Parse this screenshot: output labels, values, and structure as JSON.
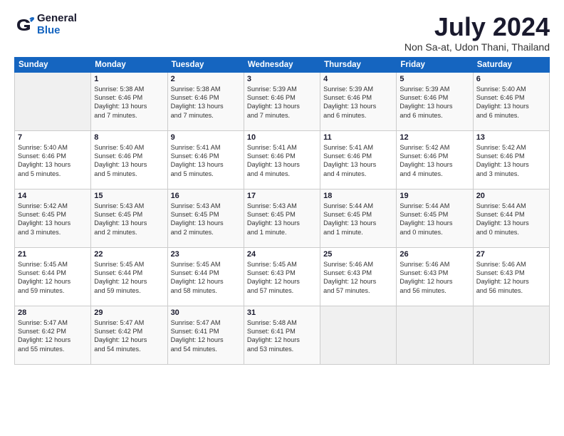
{
  "logo": {
    "general": "General",
    "blue": "Blue"
  },
  "title": "July 2024",
  "subtitle": "Non Sa-at, Udon Thani, Thailand",
  "headers": [
    "Sunday",
    "Monday",
    "Tuesday",
    "Wednesday",
    "Thursday",
    "Friday",
    "Saturday"
  ],
  "weeks": [
    [
      {
        "day": "",
        "info": ""
      },
      {
        "day": "1",
        "info": "Sunrise: 5:38 AM\nSunset: 6:46 PM\nDaylight: 13 hours\nand 7 minutes."
      },
      {
        "day": "2",
        "info": "Sunrise: 5:38 AM\nSunset: 6:46 PM\nDaylight: 13 hours\nand 7 minutes."
      },
      {
        "day": "3",
        "info": "Sunrise: 5:39 AM\nSunset: 6:46 PM\nDaylight: 13 hours\nand 7 minutes."
      },
      {
        "day": "4",
        "info": "Sunrise: 5:39 AM\nSunset: 6:46 PM\nDaylight: 13 hours\nand 6 minutes."
      },
      {
        "day": "5",
        "info": "Sunrise: 5:39 AM\nSunset: 6:46 PM\nDaylight: 13 hours\nand 6 minutes."
      },
      {
        "day": "6",
        "info": "Sunrise: 5:40 AM\nSunset: 6:46 PM\nDaylight: 13 hours\nand 6 minutes."
      }
    ],
    [
      {
        "day": "7",
        "info": "Sunrise: 5:40 AM\nSunset: 6:46 PM\nDaylight: 13 hours\nand 5 minutes."
      },
      {
        "day": "8",
        "info": "Sunrise: 5:40 AM\nSunset: 6:46 PM\nDaylight: 13 hours\nand 5 minutes."
      },
      {
        "day": "9",
        "info": "Sunrise: 5:41 AM\nSunset: 6:46 PM\nDaylight: 13 hours\nand 5 minutes."
      },
      {
        "day": "10",
        "info": "Sunrise: 5:41 AM\nSunset: 6:46 PM\nDaylight: 13 hours\nand 4 minutes."
      },
      {
        "day": "11",
        "info": "Sunrise: 5:41 AM\nSunset: 6:46 PM\nDaylight: 13 hours\nand 4 minutes."
      },
      {
        "day": "12",
        "info": "Sunrise: 5:42 AM\nSunset: 6:46 PM\nDaylight: 13 hours\nand 4 minutes."
      },
      {
        "day": "13",
        "info": "Sunrise: 5:42 AM\nSunset: 6:46 PM\nDaylight: 13 hours\nand 3 minutes."
      }
    ],
    [
      {
        "day": "14",
        "info": "Sunrise: 5:42 AM\nSunset: 6:45 PM\nDaylight: 13 hours\nand 3 minutes."
      },
      {
        "day": "15",
        "info": "Sunrise: 5:43 AM\nSunset: 6:45 PM\nDaylight: 13 hours\nand 2 minutes."
      },
      {
        "day": "16",
        "info": "Sunrise: 5:43 AM\nSunset: 6:45 PM\nDaylight: 13 hours\nand 2 minutes."
      },
      {
        "day": "17",
        "info": "Sunrise: 5:43 AM\nSunset: 6:45 PM\nDaylight: 13 hours\nand 1 minute."
      },
      {
        "day": "18",
        "info": "Sunrise: 5:44 AM\nSunset: 6:45 PM\nDaylight: 13 hours\nand 1 minute."
      },
      {
        "day": "19",
        "info": "Sunrise: 5:44 AM\nSunset: 6:45 PM\nDaylight: 13 hours\nand 0 minutes."
      },
      {
        "day": "20",
        "info": "Sunrise: 5:44 AM\nSunset: 6:44 PM\nDaylight: 13 hours\nand 0 minutes."
      }
    ],
    [
      {
        "day": "21",
        "info": "Sunrise: 5:45 AM\nSunset: 6:44 PM\nDaylight: 12 hours\nand 59 minutes."
      },
      {
        "day": "22",
        "info": "Sunrise: 5:45 AM\nSunset: 6:44 PM\nDaylight: 12 hours\nand 59 minutes."
      },
      {
        "day": "23",
        "info": "Sunrise: 5:45 AM\nSunset: 6:44 PM\nDaylight: 12 hours\nand 58 minutes."
      },
      {
        "day": "24",
        "info": "Sunrise: 5:45 AM\nSunset: 6:43 PM\nDaylight: 12 hours\nand 57 minutes."
      },
      {
        "day": "25",
        "info": "Sunrise: 5:46 AM\nSunset: 6:43 PM\nDaylight: 12 hours\nand 57 minutes."
      },
      {
        "day": "26",
        "info": "Sunrise: 5:46 AM\nSunset: 6:43 PM\nDaylight: 12 hours\nand 56 minutes."
      },
      {
        "day": "27",
        "info": "Sunrise: 5:46 AM\nSunset: 6:43 PM\nDaylight: 12 hours\nand 56 minutes."
      }
    ],
    [
      {
        "day": "28",
        "info": "Sunrise: 5:47 AM\nSunset: 6:42 PM\nDaylight: 12 hours\nand 55 minutes."
      },
      {
        "day": "29",
        "info": "Sunrise: 5:47 AM\nSunset: 6:42 PM\nDaylight: 12 hours\nand 54 minutes."
      },
      {
        "day": "30",
        "info": "Sunrise: 5:47 AM\nSunset: 6:41 PM\nDaylight: 12 hours\nand 54 minutes."
      },
      {
        "day": "31",
        "info": "Sunrise: 5:48 AM\nSunset: 6:41 PM\nDaylight: 12 hours\nand 53 minutes."
      },
      {
        "day": "",
        "info": ""
      },
      {
        "day": "",
        "info": ""
      },
      {
        "day": "",
        "info": ""
      }
    ]
  ]
}
